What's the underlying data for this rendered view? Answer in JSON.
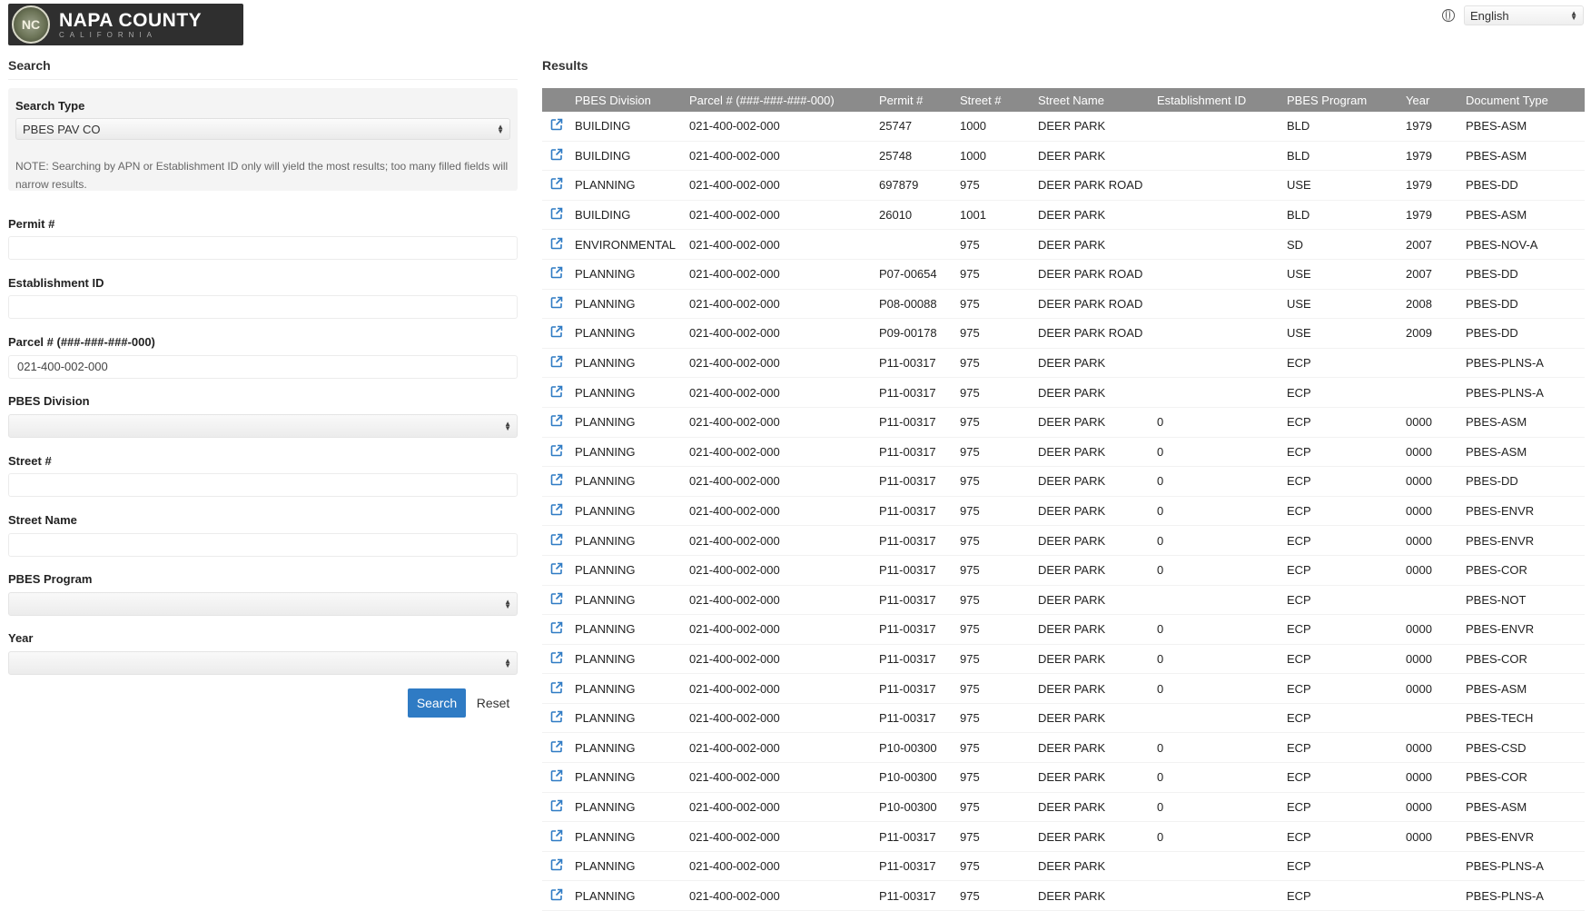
{
  "header": {
    "logo_seal": "NC",
    "logo_title": "NAPA COUNTY",
    "logo_subtitle": "CALIFORNIA",
    "language_selected": "English",
    "globe_icon": "globe-icon"
  },
  "search": {
    "heading": "Search",
    "search_type_label": "Search Type",
    "search_type_value": "PBES PAV CO",
    "note": "NOTE: Searching by APN or Establishment ID only will yield the most results; too many filled fields will narrow results.",
    "permit_label": "Permit #",
    "permit_value": "",
    "establishment_label": "Establishment ID",
    "establishment_value": "",
    "parcel_label": "Parcel # (###-###-###-000)",
    "parcel_value": "021-400-002-000",
    "division_label": "PBES Division",
    "division_value": "",
    "street_no_label": "Street #",
    "street_no_value": "",
    "street_name_label": "Street Name",
    "street_name_value": "",
    "program_label": "PBES Program",
    "program_value": "",
    "year_label": "Year",
    "year_value": "",
    "search_button": "Search",
    "reset_button": "Reset"
  },
  "results": {
    "heading": "Results",
    "columns": [
      "PBES Division",
      "Parcel # (###-###-###-000)",
      "Permit #",
      "Street #",
      "Street Name",
      "Establishment ID",
      "PBES Program",
      "Year",
      "Document Type"
    ],
    "rows": [
      [
        "BUILDING",
        "021-400-002-000",
        "25747",
        "1000",
        "DEER PARK",
        "",
        "BLD",
        "1979",
        "PBES-ASM"
      ],
      [
        "BUILDING",
        "021-400-002-000",
        "25748",
        "1000",
        "DEER PARK",
        "",
        "BLD",
        "1979",
        "PBES-ASM"
      ],
      [
        "PLANNING",
        "021-400-002-000",
        "697879",
        "975",
        "DEER PARK ROAD",
        "",
        "USE",
        "1979",
        "PBES-DD"
      ],
      [
        "BUILDING",
        "021-400-002-000",
        "26010",
        "1001",
        "DEER PARK",
        "",
        "BLD",
        "1979",
        "PBES-ASM"
      ],
      [
        "ENVIRONMENTAL",
        "021-400-002-000",
        "",
        "975",
        "DEER PARK",
        "",
        "SD",
        "2007",
        "PBES-NOV-A"
      ],
      [
        "PLANNING",
        "021-400-002-000",
        "P07-00654",
        "975",
        "DEER PARK ROAD",
        "",
        "USE",
        "2007",
        "PBES-DD"
      ],
      [
        "PLANNING",
        "021-400-002-000",
        "P08-00088",
        "975",
        "DEER PARK ROAD",
        "",
        "USE",
        "2008",
        "PBES-DD"
      ],
      [
        "PLANNING",
        "021-400-002-000",
        "P09-00178",
        "975",
        "DEER PARK ROAD",
        "",
        "USE",
        "2009",
        "PBES-DD"
      ],
      [
        "PLANNING",
        "021-400-002-000",
        "P11-00317",
        "975",
        "DEER PARK",
        "",
        "ECP",
        "",
        "PBES-PLNS-A"
      ],
      [
        "PLANNING",
        "021-400-002-000",
        "P11-00317",
        "975",
        "DEER PARK",
        "",
        "ECP",
        "",
        "PBES-PLNS-A"
      ],
      [
        "PLANNING",
        "021-400-002-000",
        "P11-00317",
        "975",
        "DEER PARK",
        "0",
        "ECP",
        "0000",
        "PBES-ASM"
      ],
      [
        "PLANNING",
        "021-400-002-000",
        "P11-00317",
        "975",
        "DEER PARK",
        "0",
        "ECP",
        "0000",
        "PBES-ASM"
      ],
      [
        "PLANNING",
        "021-400-002-000",
        "P11-00317",
        "975",
        "DEER PARK",
        "0",
        "ECP",
        "0000",
        "PBES-DD"
      ],
      [
        "PLANNING",
        "021-400-002-000",
        "P11-00317",
        "975",
        "DEER PARK",
        "0",
        "ECP",
        "0000",
        "PBES-ENVR"
      ],
      [
        "PLANNING",
        "021-400-002-000",
        "P11-00317",
        "975",
        "DEER PARK",
        "0",
        "ECP",
        "0000",
        "PBES-ENVR"
      ],
      [
        "PLANNING",
        "021-400-002-000",
        "P11-00317",
        "975",
        "DEER PARK",
        "0",
        "ECP",
        "0000",
        "PBES-COR"
      ],
      [
        "PLANNING",
        "021-400-002-000",
        "P11-00317",
        "975",
        "DEER PARK",
        "",
        "ECP",
        "",
        "PBES-NOT"
      ],
      [
        "PLANNING",
        "021-400-002-000",
        "P11-00317",
        "975",
        "DEER PARK",
        "0",
        "ECP",
        "0000",
        "PBES-ENVR"
      ],
      [
        "PLANNING",
        "021-400-002-000",
        "P11-00317",
        "975",
        "DEER PARK",
        "0",
        "ECP",
        "0000",
        "PBES-COR"
      ],
      [
        "PLANNING",
        "021-400-002-000",
        "P11-00317",
        "975",
        "DEER PARK",
        "0",
        "ECP",
        "0000",
        "PBES-ASM"
      ],
      [
        "PLANNING",
        "021-400-002-000",
        "P11-00317",
        "975",
        "DEER PARK",
        "",
        "ECP",
        "",
        "PBES-TECH"
      ],
      [
        "PLANNING",
        "021-400-002-000",
        "P10-00300",
        "975",
        "DEER PARK",
        "0",
        "ECP",
        "0000",
        "PBES-CSD"
      ],
      [
        "PLANNING",
        "021-400-002-000",
        "P10-00300",
        "975",
        "DEER PARK",
        "0",
        "ECP",
        "0000",
        "PBES-COR"
      ],
      [
        "PLANNING",
        "021-400-002-000",
        "P10-00300",
        "975",
        "DEER PARK",
        "0",
        "ECP",
        "0000",
        "PBES-ASM"
      ],
      [
        "PLANNING",
        "021-400-002-000",
        "P11-00317",
        "975",
        "DEER PARK",
        "0",
        "ECP",
        "0000",
        "PBES-ENVR"
      ],
      [
        "PLANNING",
        "021-400-002-000",
        "P11-00317",
        "975",
        "DEER PARK",
        "",
        "ECP",
        "",
        "PBES-PLNS-A"
      ],
      [
        "PLANNING",
        "021-400-002-000",
        "P11-00317",
        "975",
        "DEER PARK",
        "",
        "ECP",
        "",
        "PBES-PLNS-A"
      ]
    ],
    "row_link_icon": "external-link-icon",
    "link_color": "#2f7bc4",
    "header_bg": "#8b8b8b"
  }
}
